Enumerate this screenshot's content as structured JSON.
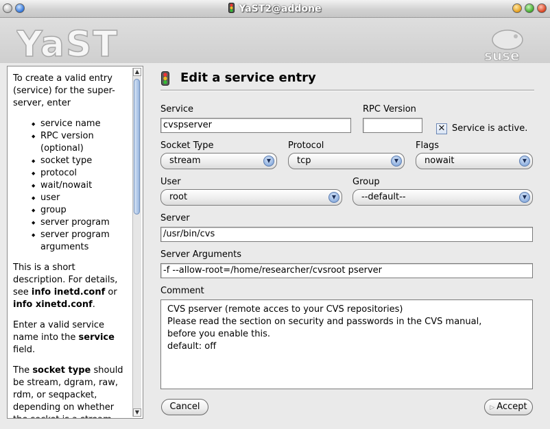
{
  "window": {
    "title": "YaST2@addone"
  },
  "banner": {
    "logo_text": "YaST",
    "vendor_text": "suse"
  },
  "help": {
    "intro": "To create a valid entry (service) for the super-server, enter",
    "items": [
      "service name",
      "RPC version (optional)",
      "socket type",
      "protocol",
      "wait/nowait",
      "user",
      "group",
      "server program",
      "server program arguments"
    ],
    "p2": {
      "a": "This is a short description. For details, see ",
      "b": "info inetd.conf",
      "c": " or ",
      "d": "info xinetd.conf",
      "e": "."
    },
    "p3": {
      "a": "Enter a valid service name into the ",
      "b": "service",
      "c": " field."
    },
    "p4": {
      "a": "The ",
      "b": "socket type",
      "c": " should be stream, dgram, raw, rdm, or seqpacket, depending on whether the socket is a stream, datagram, or reliably"
    }
  },
  "form": {
    "heading": "Edit a service entry",
    "service": {
      "label": "Service",
      "value": "cvspserver"
    },
    "rpc": {
      "label": "RPC Version",
      "value": ""
    },
    "active": {
      "label": "Service is active.",
      "checked": true
    },
    "socket_type": {
      "label": "Socket Type",
      "value": "stream"
    },
    "protocol": {
      "label": "Protocol",
      "value": "tcp"
    },
    "flags": {
      "label": "Flags",
      "value": "nowait"
    },
    "user": {
      "label": "User",
      "value": "root"
    },
    "group": {
      "label": "Group",
      "value": "--default--"
    },
    "server": {
      "label": "Server",
      "value": "/usr/bin/cvs"
    },
    "server_args": {
      "label": "Server Arguments",
      "value": "-f --allow-root=/home/researcher/cvsroot pserver"
    },
    "comment": {
      "label": "Comment",
      "value": "CVS pserver (remote acces to your CVS repositories)\nPlease read the section on security and passwords in the CVS manual,\nbefore you enable this.\ndefault: off"
    }
  },
  "buttons": {
    "cancel": "Cancel",
    "accept": "Accept"
  }
}
